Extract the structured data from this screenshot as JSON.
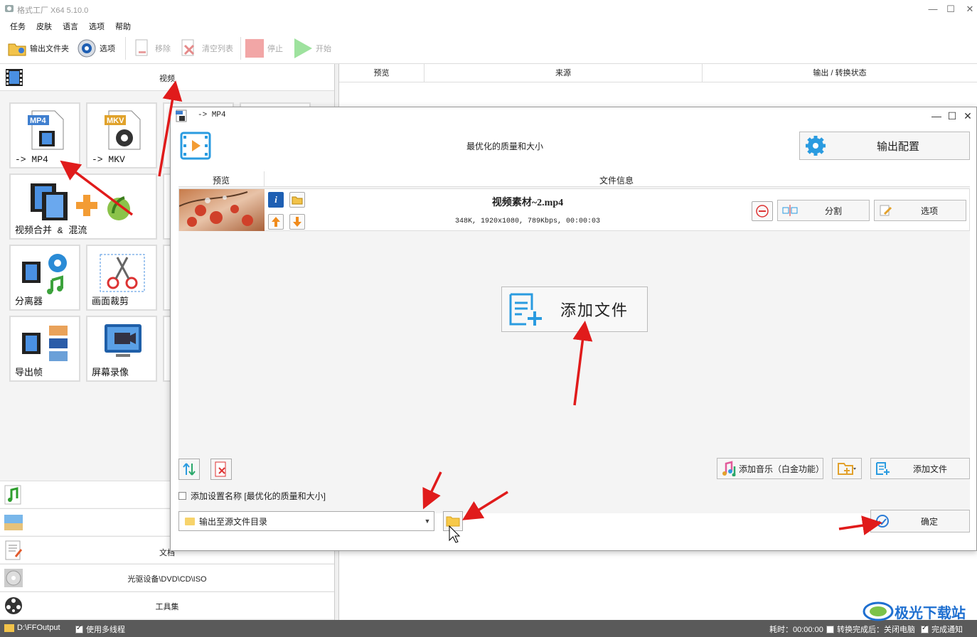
{
  "window": {
    "title": "格式工厂 X64 5.10.0",
    "min": "—",
    "max": "☐",
    "close": "✕"
  },
  "menu": [
    "任务",
    "皮肤",
    "语言",
    "选项",
    "帮助"
  ],
  "toolbar": {
    "output_folder": "输出文件夹",
    "options": "选项",
    "remove": "移除",
    "clear_list": "清空列表",
    "stop": "停止",
    "start": "开始"
  },
  "left": {
    "category_video": "视频",
    "tiles": {
      "mp4": "-> MP4",
      "mkv": "-> MKV",
      "merge": "视频合并 & 混流",
      "splitter": "分离器",
      "crop": "画面裁剪",
      "export_frames": "导出帧",
      "screen_record": "屏幕录像"
    },
    "bottom": {
      "document": "文档",
      "optical": "光驱设备\\DVD\\CD\\ISO",
      "tools": "工具集"
    }
  },
  "list_headers": [
    "预览",
    "来源",
    "输出 / 转换状态"
  ],
  "status": {
    "path": "D:\\FFOutput",
    "multithread": "使用多线程",
    "elapsed": "耗时：00:00:00",
    "shutdown": "转换完成后：关闭电脑",
    "notify": "完成通知"
  },
  "dialog": {
    "title": "-> MP4",
    "quality": "最优化的质量和大小",
    "output_config": "输出配置",
    "table_headers": {
      "preview": "预览",
      "info": "文件信息"
    },
    "file": {
      "name": "视频素材~2.mp4",
      "meta": "348K, 1920x1080, 789Kbps, 00:00:03"
    },
    "split": "分割",
    "options": "选项",
    "add_file_big": "添加文件",
    "add_music": "添加音乐（白金功能）",
    "add_file": "添加文件",
    "add_setting_name": "添加设置名称 [最优化的质量和大小]",
    "output_dir": "输出至源文件目录",
    "ok": "确定"
  },
  "watermark": "极光下载站"
}
